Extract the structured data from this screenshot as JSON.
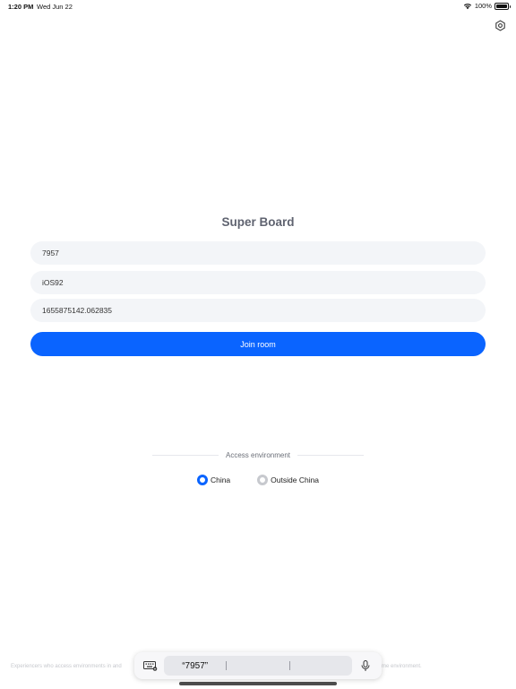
{
  "status_bar": {
    "time": "1:20 PM",
    "date": "Wed Jun 22",
    "battery": "100%"
  },
  "page": {
    "title": "Super Board"
  },
  "form": {
    "room_id_value": "7957",
    "user_name_value": "iOS92",
    "uid_value": "1655875142.062835",
    "join_label": "Join room"
  },
  "environment": {
    "label": "Access environment",
    "options": [
      {
        "label": "China",
        "selected": true
      },
      {
        "label": "Outside China",
        "selected": false
      }
    ]
  },
  "footer": {
    "left_text": "Experiencers who access environments in and",
    "right_text": "me environment."
  },
  "keyboard_bar": {
    "suggestions": [
      "“7957”",
      "",
      ""
    ]
  },
  "colors": {
    "accent": "#0a64ff",
    "field_bg": "#f3f5f8",
    "title": "#5f6370"
  },
  "icons": {
    "settings": "gear-icon",
    "wifi": "wifi-icon",
    "battery": "battery-icon",
    "keyboard": "keyboard-icon",
    "mic": "microphone-icon"
  }
}
